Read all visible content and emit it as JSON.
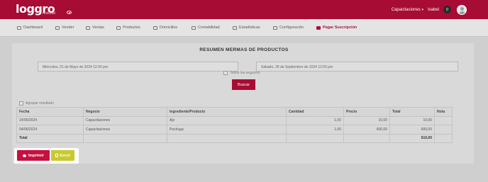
{
  "header": {
    "logo_text": "loggro",
    "logo_sub": "restobar",
    "company_menu": "Capacitaciones",
    "caret": "▾",
    "user_name": "Isabel",
    "notification_count": "0"
  },
  "nav": {
    "items": [
      {
        "label": "Dashboard",
        "icon": "dashboard-icon"
      },
      {
        "label": "Vender",
        "icon": "cart-icon"
      },
      {
        "label": "Ventas",
        "icon": "tag-icon"
      },
      {
        "label": "Productos",
        "icon": "box-icon"
      },
      {
        "label": "Domicilios",
        "icon": "bike-icon"
      },
      {
        "label": "Contabilidad",
        "icon": "calculator-icon"
      },
      {
        "label": "Estadísticas",
        "icon": "chart-icon"
      },
      {
        "label": "Configuración",
        "icon": "gear-icon"
      },
      {
        "label": "Pagar Suscripción",
        "icon": "card-icon"
      }
    ]
  },
  "report": {
    "title": "RESUMEN MERMAS DE PRODUCTOS",
    "start_date": "Miércoles, 01 de Mayo de 2024 12:00 pm",
    "end_date": "Sábado, 28 de Septiembre de 2024 12:00 pm",
    "all_businesses_label": "Todos los negocios",
    "search_button": "Buscar",
    "group_result_label": "Agrupar resultado"
  },
  "table": {
    "headers": [
      "Fecha",
      "Negocio",
      "Ingrediente/Producto",
      "Cantidad",
      "Precio",
      "Total",
      "Nota"
    ],
    "rows": [
      [
        "14/05/2024",
        "Capacitaciones",
        "Ajo",
        "1,00",
        "10,00",
        "10,00",
        ""
      ],
      [
        "04/06/2024",
        "Capacitaciones",
        "Pechuga",
        "1,00",
        "600,00",
        "600,00",
        ""
      ]
    ],
    "total_label": "Total",
    "total_value": "610,00"
  },
  "export": {
    "print_label": "Imprimir",
    "excel_label": "Excel"
  },
  "colors": {
    "brand": "#a60c34",
    "print": "#c7103f",
    "excel": "#c9c92b"
  }
}
